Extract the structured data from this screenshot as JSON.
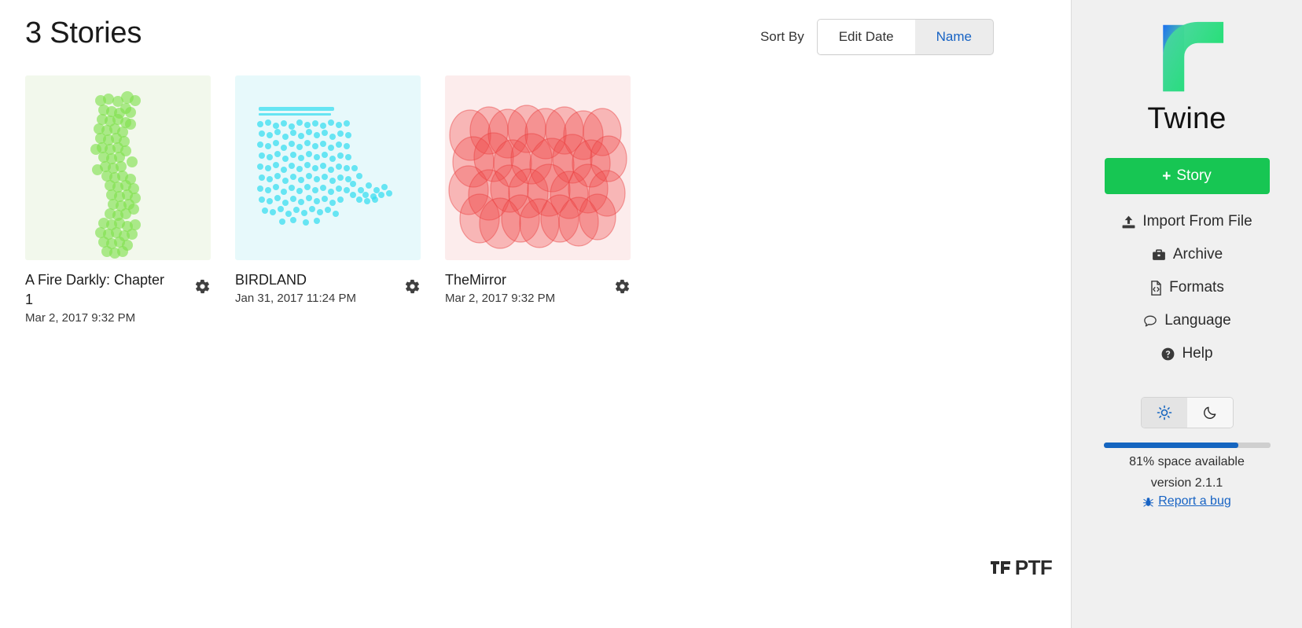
{
  "header": {
    "story_count_label": "3 Stories",
    "sort_by_label": "Sort By",
    "sort_options": [
      {
        "label": "Edit Date",
        "active": true
      },
      {
        "label": "Name",
        "active": false
      }
    ]
  },
  "stories": [
    {
      "title": "A Fire Darkly: Chapter 1",
      "date": "Mar 2, 2017 9:32 PM",
      "thumb_bg": "#f2f8ec",
      "thumb_color": "#7ee04a",
      "gear_icon": "gear-icon"
    },
    {
      "title": "BIRDLAND",
      "date": "Jan 31, 2017 11:24 PM",
      "thumb_bg": "#e7f9fb",
      "thumb_color": "#35dcf0",
      "gear_icon": "gear-icon"
    },
    {
      "title": "TheMirror",
      "date": "Mar 2, 2017 9:32 PM",
      "thumb_bg": "#fcecec",
      "thumb_color": "#f04a4a",
      "gear_icon": "gear-icon"
    }
  ],
  "sidebar": {
    "brand_name": "Twine",
    "logo_icon": "twine-logo-icon",
    "new_story_label": "Story",
    "new_story_plus": "+",
    "new_story_color": "#17c653",
    "menu_items": [
      {
        "label": "Import From File",
        "icon": "upload-icon"
      },
      {
        "label": "Archive",
        "icon": "briefcase-icon"
      },
      {
        "label": "Formats",
        "icon": "file-code-icon"
      },
      {
        "label": "Language",
        "icon": "speech-bubble-icon"
      },
      {
        "label": "Help",
        "icon": "help-circle-icon"
      }
    ],
    "theme": {
      "light_icon": "sun-icon",
      "dark_icon": "moon-icon",
      "active": "light",
      "accent_color": "#1565c0"
    },
    "storage": {
      "percent": 81,
      "label": "81% space available",
      "bar_color": "#1565c0"
    },
    "version_label": "version 2.1.1",
    "bug_report": {
      "label": "Report a bug",
      "icon": "bug-icon",
      "color": "#1763c4"
    }
  },
  "watermark": {
    "text": "PTF",
    "icon": "ptf-mark-icon"
  }
}
